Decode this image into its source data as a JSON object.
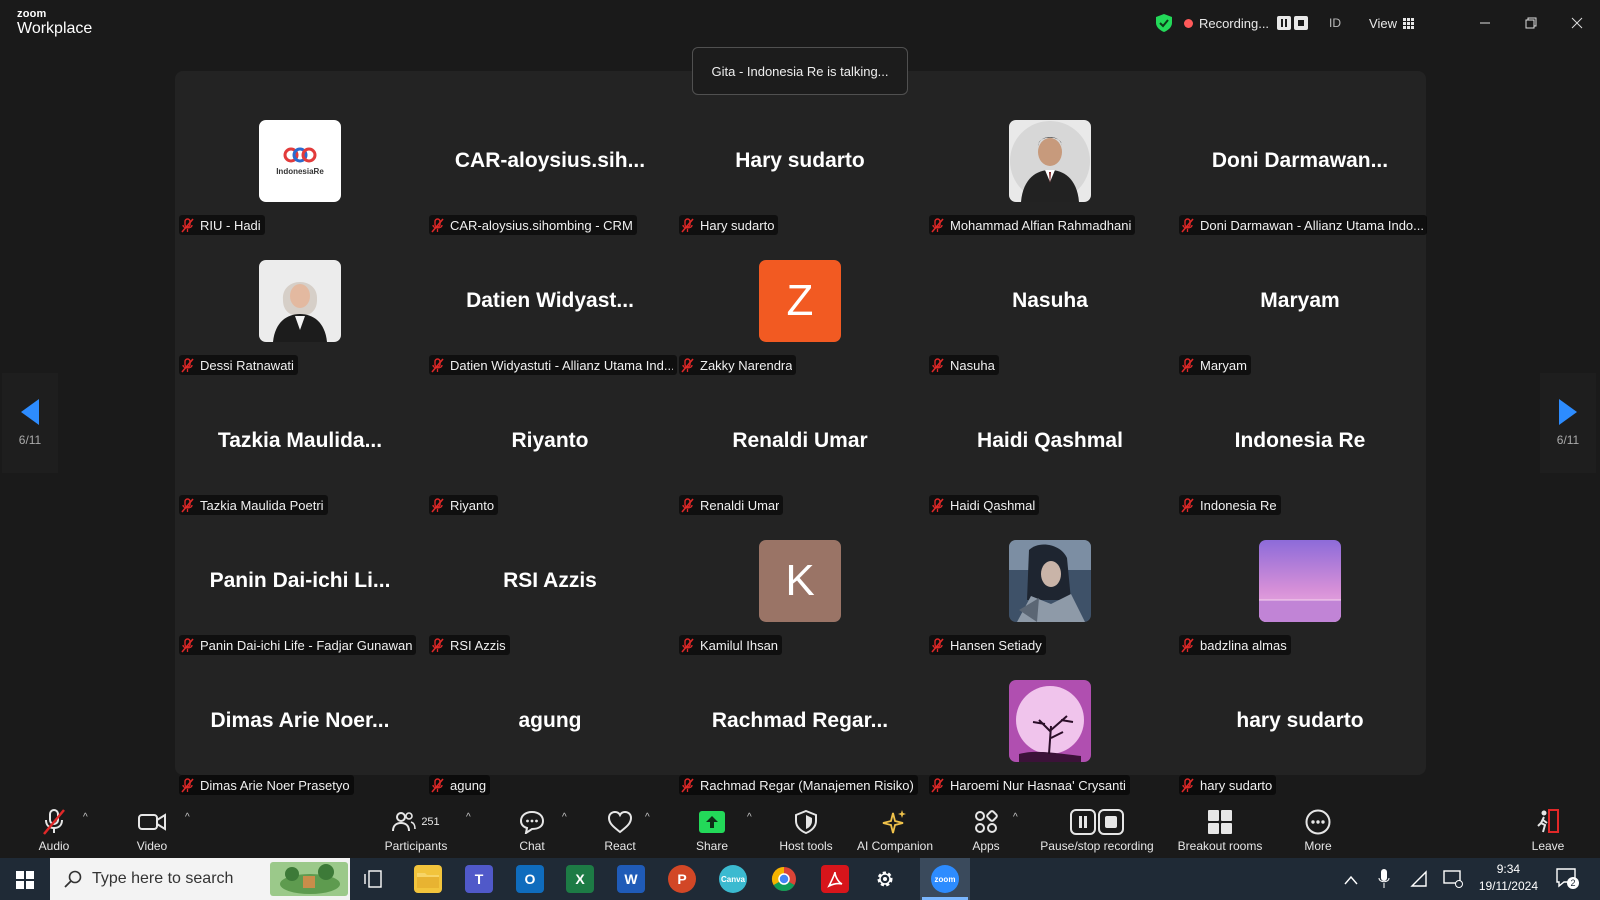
{
  "app": {
    "brand_small": "zoom",
    "brand_large": "Workplace"
  },
  "titlebar": {
    "recording_label": "Recording...",
    "id_label": "ID",
    "view_label": "View"
  },
  "toast": "Gita - Indonesia Re is talking...",
  "pagination": {
    "left_page": "6/11",
    "right_page": "6/11"
  },
  "tiles": [
    {
      "label": "RIU - Hadi",
      "avatar": "logo",
      "logo_text": "IndonesiaRe"
    },
    {
      "label": "CAR-aloysius.sihombing - CRM",
      "display": "CAR-aloysius.sih..."
    },
    {
      "label": "Hary sudarto",
      "display": "Hary sudarto"
    },
    {
      "label": "Mohammad Alfian Rahmadhani",
      "avatar": "photo-man"
    },
    {
      "label": "Doni Darmawan - Allianz Utama Indo...",
      "display": "Doni  Darmawan..."
    },
    {
      "label": "Dessi Ratnawati",
      "avatar": "photo-woman"
    },
    {
      "label": "Datien Widyastuti - Allianz Utama Ind...",
      "display": "Datien  Widyast..."
    },
    {
      "label": "Zakky Narendra",
      "avatar": "letter",
      "letter": "Z",
      "color": "#f25a22"
    },
    {
      "label": "Nasuha",
      "display": "Nasuha"
    },
    {
      "label": "Maryam",
      "display": "Maryam"
    },
    {
      "label": "Tazkia Maulida Poetri",
      "display": "Tazkia  Maulida..."
    },
    {
      "label": "Riyanto",
      "display": "Riyanto"
    },
    {
      "label": "Renaldi Umar",
      "display": "Renaldi Umar"
    },
    {
      "label": "Haidi Qashmal",
      "display": "Haidi Qashmal"
    },
    {
      "label": "Indonesia Re",
      "display": "Indonesia Re"
    },
    {
      "label": "Panin Dai-ichi Life - Fadjar Gunawan",
      "display": "Panin  Dai-ichi  Li..."
    },
    {
      "label": "RSI Azzis",
      "display": "RSI Azzis"
    },
    {
      "label": "Kamilul Ihsan",
      "avatar": "letter",
      "letter": "K",
      "color": "#9a7466"
    },
    {
      "label": "Hansen Setiady",
      "avatar": "photo-warrior"
    },
    {
      "label": "badzlina almas",
      "avatar": "photo-sunset"
    },
    {
      "label": "Dimas Arie Noer Prasetyo",
      "display": "Dimas  Arie  Noer..."
    },
    {
      "label": "agung",
      "display": "agung"
    },
    {
      "label": "Rachmad Regar (Manajemen Risiko)",
      "display": "Rachmad  Regar..."
    },
    {
      "label": "Haroemi Nur Hasnaa' Crysanti",
      "avatar": "photo-moon"
    },
    {
      "label": "hary sudarto",
      "display": "hary sudarto"
    }
  ],
  "toolbar": {
    "audio": "Audio",
    "video": "Video",
    "participants": "Participants",
    "participants_count": "251",
    "chat": "Chat",
    "react": "React",
    "share": "Share",
    "host_tools": "Host tools",
    "ai_companion": "AI Companion",
    "apps": "Apps",
    "pause_stop": "Pause/stop recording",
    "breakout": "Breakout rooms",
    "more": "More",
    "leave": "Leave"
  },
  "taskbar": {
    "search_placeholder": "Type here to search",
    "time": "9:34",
    "date": "19/11/2024",
    "notification_count": "2",
    "canva_label": "Canva"
  },
  "colors": {
    "share_green": "#23d959",
    "leave_red": "#e02828",
    "ai_gold": "#f0c24a",
    "mic_muted": "#e02828"
  }
}
